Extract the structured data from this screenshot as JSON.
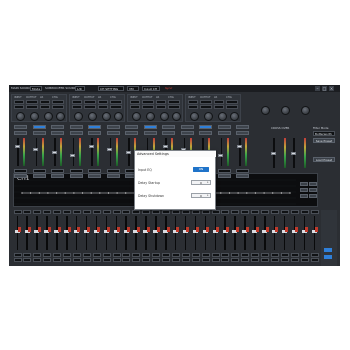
{
  "topbar": {
    "items": [
      {
        "label": "MAIN SOURCE",
        "value": "Mode"
      },
      {
        "label": "SUBWOOFER SOURCE",
        "value": "L/R"
      },
      {
        "label": "",
        "value": "CH SETTING"
      },
      {
        "label": "",
        "value": "VM"
      },
      {
        "label": "",
        "value": "Input CH"
      }
    ],
    "brand": "Sync"
  },
  "channel_strip_labels": [
    "INPUT",
    "OUTPUT",
    "LR",
    "CHG"
  ],
  "right_panel": {
    "cross_over_label": "CROSS OVER",
    "filter_mode_label": "Filter Mode",
    "filter_mode_value": "Butterworth",
    "save_preset_label": "Save Preset",
    "load_preset_label": "Load Preset"
  },
  "eq": {
    "title": "CH1",
    "bands": 32,
    "levels": [
      0,
      0,
      0,
      0,
      0,
      0,
      0,
      0,
      0,
      0,
      0,
      0,
      0,
      0,
      0,
      0,
      0,
      0,
      0,
      0,
      0,
      0,
      0,
      0,
      0,
      0,
      0,
      0,
      0,
      0,
      0,
      0
    ]
  },
  "bank_channels": 31,
  "dialog": {
    "title": "Advanced Settings",
    "rows": [
      {
        "label": "Input EQ",
        "value": "ON"
      },
      {
        "label": "Delay Startup",
        "value": "0",
        "unit": "s"
      },
      {
        "label": "Delay Shutdown",
        "value": "0",
        "unit": "s"
      }
    ]
  },
  "colors": {
    "accent": "#1f73c9",
    "background": "#2b2e33",
    "panel": "#30343a",
    "meter_red": "#c0392b"
  }
}
